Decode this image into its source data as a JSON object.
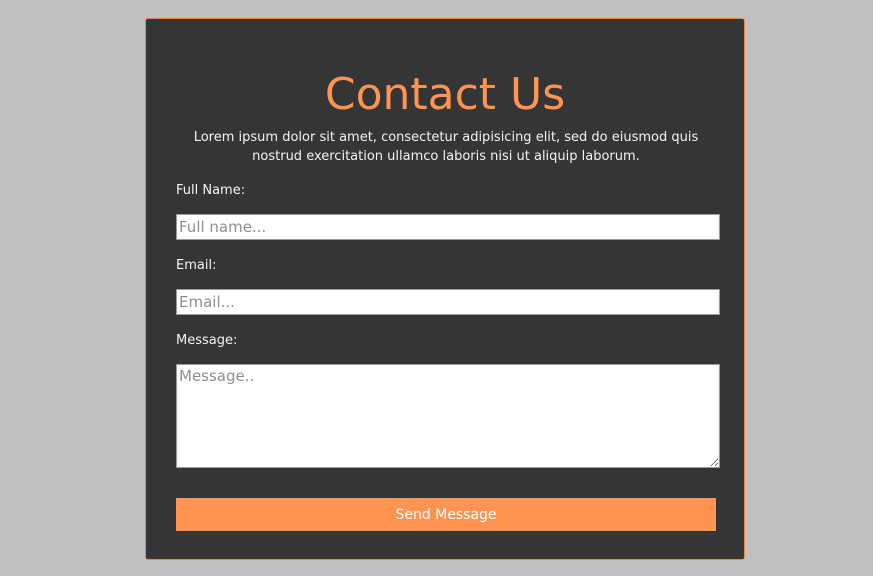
{
  "form": {
    "title": "Contact Us",
    "description": "Lorem ipsum dolor sit amet, consectetur adipisicing elit, sed do eiusmod quis nostrud exercitation ullamco laboris nisi ut aliquip laborum.",
    "full_name_label": "Full Name:",
    "full_name_placeholder": "Full name...",
    "full_name_value": "",
    "email_label": "Email:",
    "email_placeholder": "Email...",
    "email_value": "",
    "message_label": "Message:",
    "message_placeholder": "Message..",
    "message_value": "",
    "submit_label": "Send Message"
  },
  "colors": {
    "page_background": "#c0c0c0",
    "card_background": "#353535",
    "accent": "#ff9452",
    "text": "#f3f3f3"
  }
}
